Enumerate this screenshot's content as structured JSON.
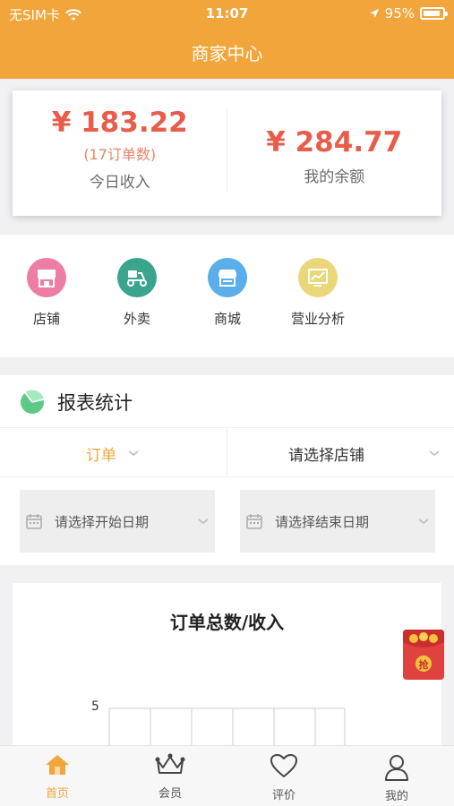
{
  "status_bar": {
    "carrier": "无SIM卡",
    "time": "11:07",
    "battery": "95%"
  },
  "nav": {
    "title": "商家中心"
  },
  "income": {
    "today_amount": "¥ 183.22",
    "today_orders": "(17订单数)",
    "today_label": "今日收入",
    "balance_amount": "¥ 284.77",
    "balance_label": "我的余额"
  },
  "menu": {
    "items": [
      {
        "label": "店铺",
        "icon": "store-icon",
        "color": "#ee7da6"
      },
      {
        "label": "外卖",
        "icon": "delivery-scooter-icon",
        "color": "#3aa58c"
      },
      {
        "label": "商城",
        "icon": "shop-icon",
        "color": "#5aaee9"
      },
      {
        "label": "营业分析",
        "icon": "analytics-chart-icon",
        "color": "#ead77a"
      }
    ]
  },
  "report": {
    "title": "报表统计",
    "type_filter": "订单",
    "store_filter": "请选择店铺",
    "start_date_placeholder": "请选择开始日期",
    "end_date_placeholder": "请选择结束日期"
  },
  "chart": {
    "title": "订单总数/收入",
    "y_tick_top": "5"
  },
  "red_packet": {
    "label": "抢"
  },
  "tabbar": {
    "items": [
      {
        "label": "首页",
        "icon": "home-icon",
        "active": true
      },
      {
        "label": "会员",
        "icon": "crown-icon",
        "active": false
      },
      {
        "label": "评价",
        "icon": "heart-icon",
        "active": false
      },
      {
        "label": "我的",
        "icon": "person-icon",
        "active": false
      }
    ]
  },
  "colors": {
    "brand": "#f2a53a",
    "amount": "#e85c4a"
  }
}
